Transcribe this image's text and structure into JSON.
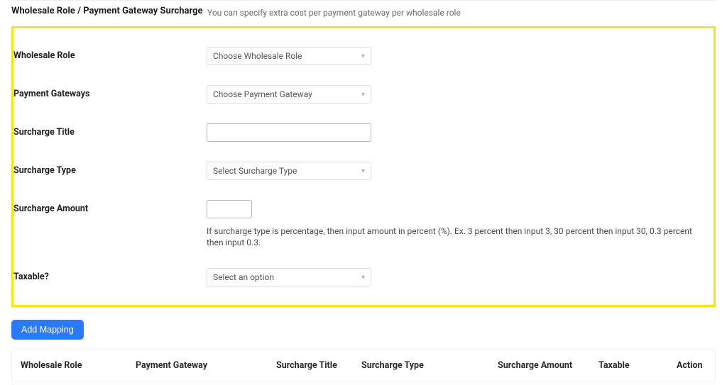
{
  "header": {
    "title": "Wholesale Role / Payment Gateway Surcharge",
    "description": "You can specify extra cost per payment gateway per wholesale role"
  },
  "form": {
    "wholesale_role": {
      "label": "Wholesale Role",
      "placeholder": "Choose Wholesale Role"
    },
    "payment_gateways": {
      "label": "Payment Gateways",
      "placeholder": "Choose Payment Gateway"
    },
    "surcharge_title": {
      "label": "Surcharge Title",
      "value": ""
    },
    "surcharge_type": {
      "label": "Surcharge Type",
      "placeholder": "Select Surcharge Type"
    },
    "surcharge_amount": {
      "label": "Surcharge Amount",
      "value": "",
      "hint": "If surcharge type is percentage, then input amount in percent (%). Ex. 3 percent then input 3, 30 percent then input 30, 0.3 percent then input 0.3."
    },
    "taxable": {
      "label": "Taxable?",
      "placeholder": "Select an option"
    }
  },
  "buttons": {
    "add_mapping": "Add Mapping"
  },
  "table": {
    "columns": {
      "wholesale_role": "Wholesale Role",
      "payment_gateway": "Payment Gateway",
      "surcharge_title": "Surcharge Title",
      "surcharge_type": "Surcharge Type",
      "surcharge_amount": "Surcharge Amount",
      "taxable": "Taxable",
      "action": "Action"
    }
  }
}
